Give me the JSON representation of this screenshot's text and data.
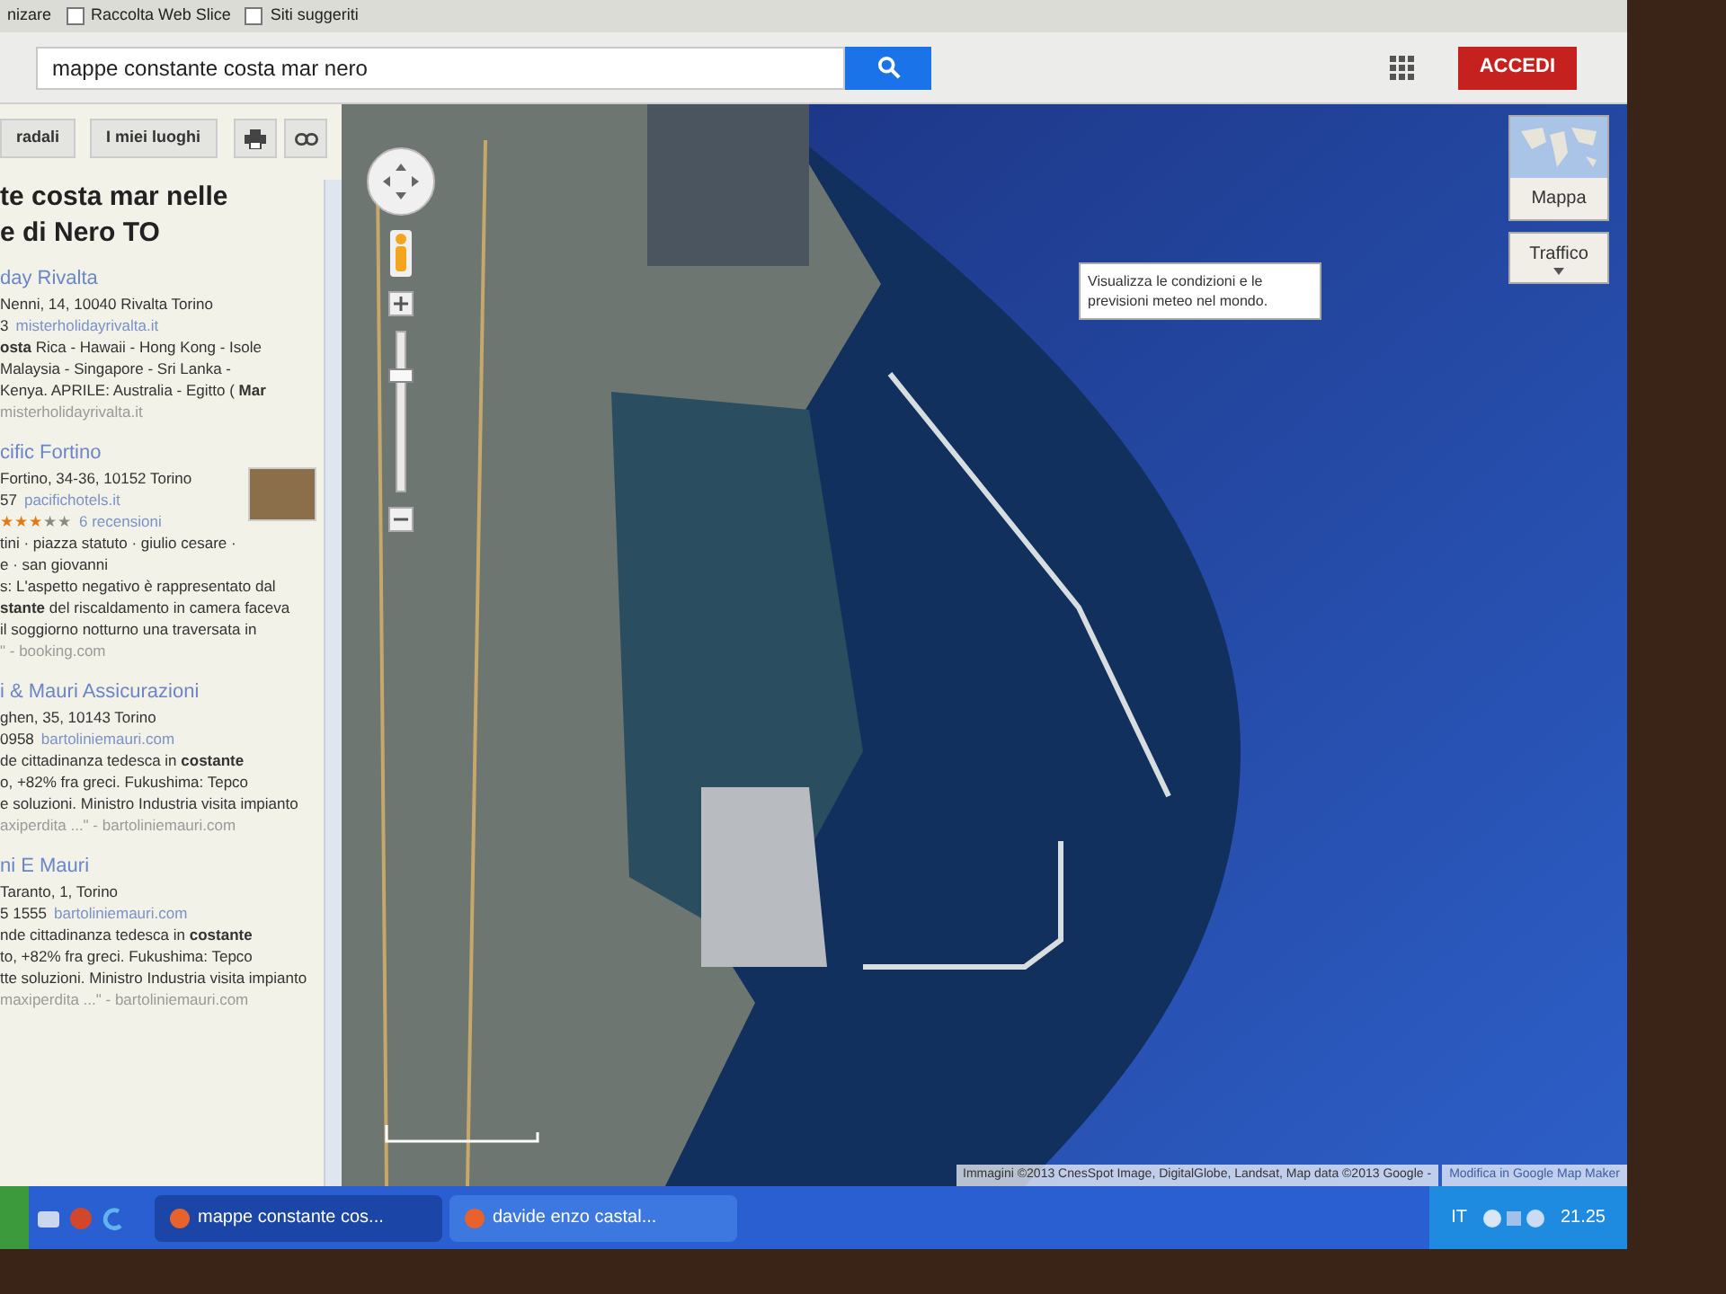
{
  "bookmarks_bar": {
    "items": [
      {
        "label": "nizare",
        "kind": "text"
      },
      {
        "label": "Raccolta Web Slice",
        "kind": "folder"
      },
      {
        "label": "Siti suggeriti",
        "kind": "folder"
      }
    ]
  },
  "search": {
    "value": "mappe constante costa mar nero"
  },
  "header": {
    "sign_in": "ACCEDI"
  },
  "panel": {
    "buttons": [
      "radali",
      "I miei luoghi"
    ],
    "title": [
      "te costa mar nelle",
      "e di Nero TO"
    ],
    "results": [
      {
        "name": "day Rivalta",
        "address": "Nenni, 14, 10040 Rivalta Torino",
        "phone": "3",
        "link": "misterholidayrivalta.it",
        "snippet": [
          "**osta** Rica - Hawaii - Hong Kong - Isole",
          "Malaysia - Singapore - Sri Lanka -",
          "Kenya. APRILE: Australia - Egitto ( **Mar**"
        ],
        "source": "misterholidayrivalta.it"
      },
      {
        "name": "cific Fortino",
        "address": "Fortino, 34-36, 10152 Torino",
        "phone": "57",
        "link": "pacifichotels.it",
        "stars": 3,
        "reviews": "6 recensioni",
        "thumbnail": true,
        "snippet": [
          "tini · piazza statuto · giulio cesare ·",
          "e · san giovanni",
          "s: L'aspetto negativo è rappresentato dal",
          "**stante** del riscaldamento in camera faceva",
          "il soggiorno notturno una traversata in"
        ],
        "source": "\" - booking.com"
      },
      {
        "name": "i & Mauri Assicurazioni",
        "address": "ghen, 35, 10143 Torino",
        "phone": "0958",
        "link": "bartoliniemauri.com",
        "snippet": [
          "de cittadinanza tedesca in **costante**",
          "o, +82% fra greci. Fukushima: Tepco",
          "e soluzioni. Ministro Industria visita impianto"
        ],
        "source": "axiperdita ...\" - bartoliniemauri.com"
      },
      {
        "name": "ni E Mauri",
        "address": "Taranto, 1, Torino",
        "phone": "5 1555",
        "link": "bartoliniemauri.com",
        "snippet": [
          "nde cittadinanza tedesca in **costante**",
          "to, +82% fra greci. Fukushima: Tepco",
          "tte soluzioni. Ministro Industria visita impianto"
        ],
        "source": "maxiperdita ...\" - bartoliniemauri.com"
      }
    ]
  },
  "map": {
    "zoom": {
      "level": 0.75
    },
    "tooltip": "Visualizza le condizioni e le previsioni meteo nel mondo.",
    "map_type": "Mappa",
    "traffic": "Traffico",
    "attribution": "Immagini ©2013 CnesSpot Image, DigitalGlobe, Landsat, Map data ©2013 Google -",
    "edit_link": "Modifica in Google Map Maker"
  },
  "taskbar": {
    "tasks": [
      {
        "label": "mappe constante cos...",
        "selected": true
      },
      {
        "label": "davide enzo castal...",
        "selected": false
      }
    ],
    "language": "IT",
    "time": "21.25"
  }
}
